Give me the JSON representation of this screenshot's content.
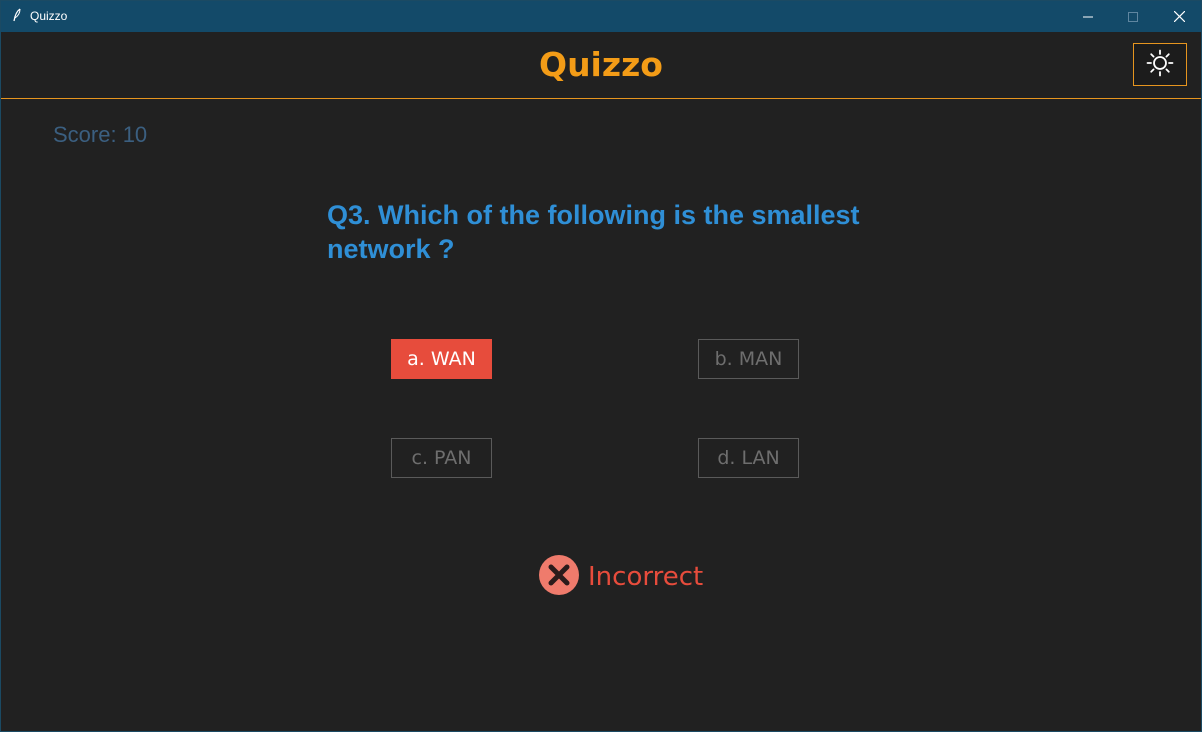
{
  "window": {
    "title": "Quizzo",
    "minimize_icon": "minimize-icon",
    "maximize_icon": "maximize-icon",
    "close_icon": "close-icon"
  },
  "header": {
    "title": "Quizzo",
    "theme_toggle_icon": "sun-icon"
  },
  "score": {
    "label": "Score: 10"
  },
  "question": {
    "text": "Q3. Which of the following is the smallest network ?"
  },
  "options": [
    {
      "label": "a. WAN",
      "state": "incorrect-selected"
    },
    {
      "label": "b. MAN",
      "state": "default"
    },
    {
      "label": "c. PAN",
      "state": "default"
    },
    {
      "label": "d. LAN",
      "state": "default"
    }
  ],
  "feedback": {
    "icon": "x-circle-icon",
    "text": "Incorrect"
  },
  "colors": {
    "titlebar": "#134a69",
    "accent": "#f39c17",
    "question": "#2f8fd6",
    "score": "#3b5f80",
    "error": "#e74c3c",
    "background": "#212121"
  }
}
